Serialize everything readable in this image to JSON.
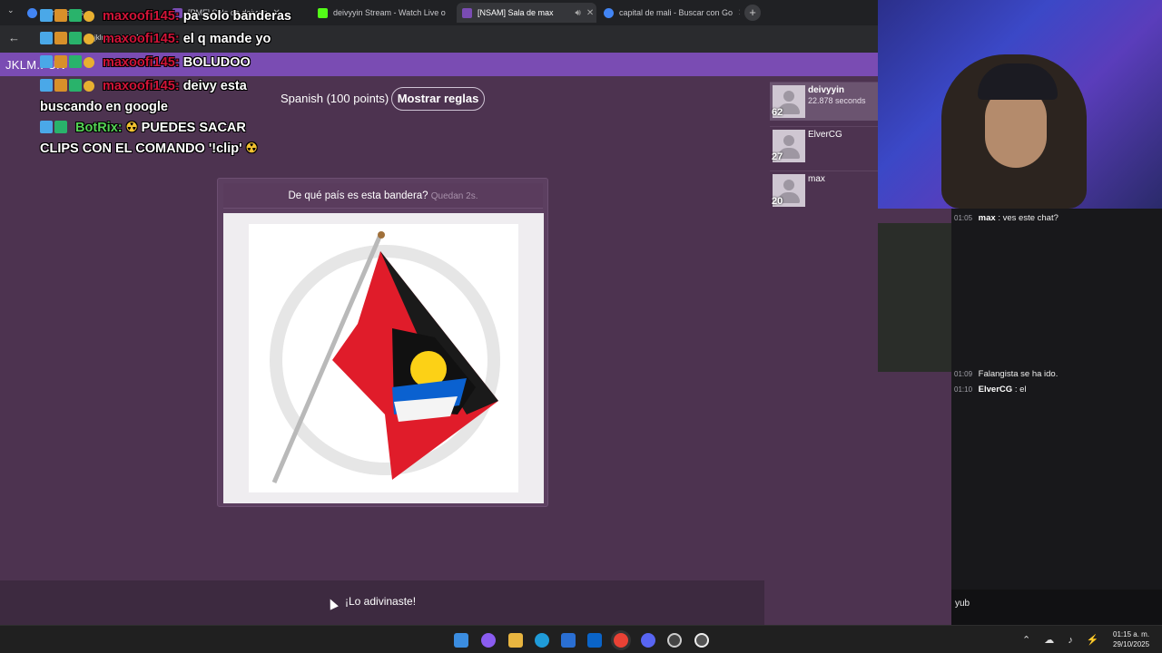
{
  "browser": {
    "tabs": [
      {
        "label": "puntarenas -"
      },
      {
        "label": "[PMF] Sala de deivyin"
      },
      {
        "label": "deivyyin Stream - Watch Live o"
      },
      {
        "label": "[NSAM] Sala de max"
      },
      {
        "label": "capital de mali - Buscar con Go"
      }
    ],
    "url": "jklm.fun/NSAM"
  },
  "site": {
    "brand": "JKLM.FUN",
    "language": "Spanish (100 points)",
    "rules_button": "Mostrar reglas",
    "question": "De qué país es esta bandera?",
    "time_left": "Quedan 2s.",
    "scores": [
      {
        "points": "62",
        "name": "deivyyin",
        "sub": "22.878 seconds"
      },
      {
        "points": "27",
        "name": "ElverCG",
        "sub": ""
      },
      {
        "points": "20",
        "name": "max",
        "sub": ""
      }
    ],
    "guessed_text": "¡Lo adivinaste!"
  },
  "overlay_chat": [
    {
      "user": "maxoofi145:",
      "text": "pa solo banderas"
    },
    {
      "user": "maxoofi145:",
      "text": "el q mande yo"
    },
    {
      "user": "maxoofi145:",
      "text": "BOLUDOO"
    },
    {
      "user": "maxoofi145:",
      "text": "deivy esta buscando en google"
    },
    {
      "user": "BotRix:",
      "text": "PUEDES SACAR CLIPS CON EL COMANDO '!clip'"
    }
  ],
  "twitch_chat": {
    "lines": [
      {
        "time": "01:05",
        "user": "max",
        "text": ": ves este chat?"
      },
      {
        "time": "01:09",
        "user": "",
        "text": "Falangista se ha ido."
      },
      {
        "time": "01:10",
        "user": "ElverCG",
        "text": ": el"
      }
    ],
    "input_value": "yub"
  },
  "taskbar": {
    "time": "01:15 a. m.",
    "date": "29/10/2025"
  },
  "colors": {
    "site_bg": "#4d3350",
    "site_header": "#7a4cb3",
    "chat_username": "#d01438",
    "bot_username": "#54d254"
  }
}
